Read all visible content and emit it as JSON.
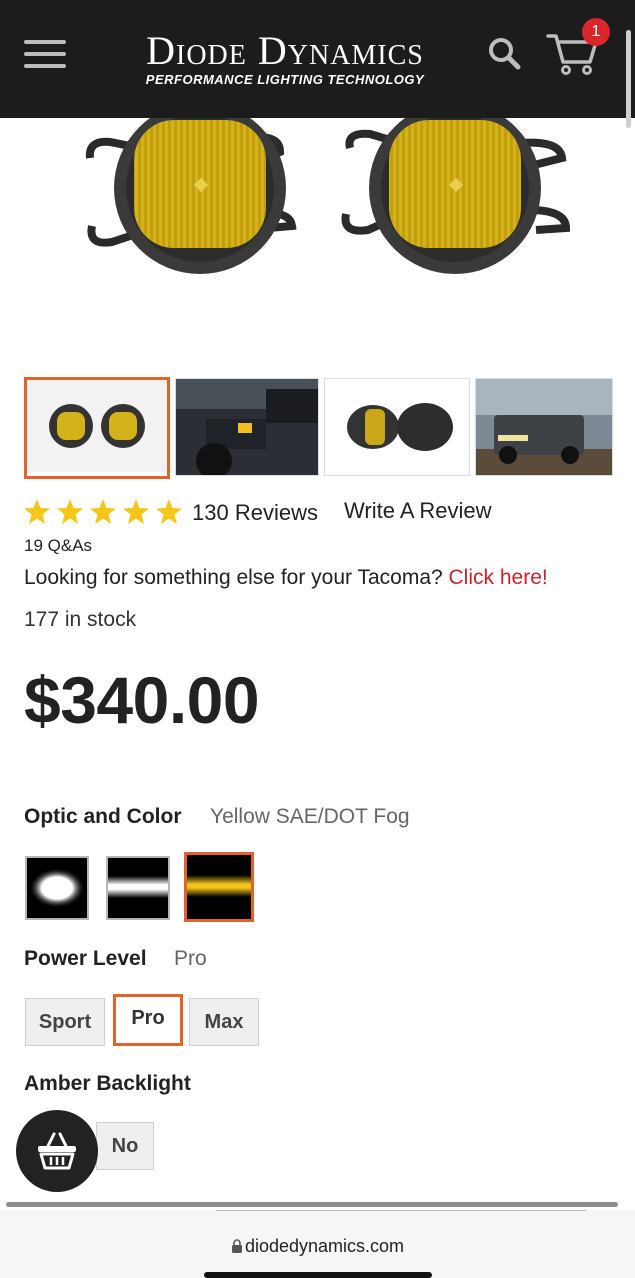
{
  "header": {
    "brand": "Diode Dynamics",
    "tagline": "PERFORMANCE LIGHTING TECHNOLOGY",
    "cart_count": "1"
  },
  "gallery": {
    "thumbnails": [
      "fog-lights-pair",
      "tacoma-front-bumper",
      "fog-lights-side",
      "tacoma-truck"
    ],
    "active_index": 0
  },
  "reviews": {
    "rating": 5,
    "count_label": "130 Reviews",
    "write_label": "Write A Review",
    "qa_label": "19 Q&As"
  },
  "promo": {
    "text": "Looking for something else for your Tacoma? ",
    "link": "Click here!"
  },
  "stock": "177 in stock",
  "price": "$340.00",
  "options": {
    "optic": {
      "label": "Optic and Color",
      "value": "Yellow SAE/DOT Fog",
      "swatches": [
        "white-flood",
        "white-fog",
        "yellow-fog"
      ],
      "selected": "yellow-fog"
    },
    "power": {
      "label": "Power Level",
      "value": "Pro",
      "choices": [
        "Sport",
        "Pro",
        "Max"
      ],
      "selected": "Pro"
    },
    "backlight": {
      "label": "Amber Backlight",
      "choices": [
        "No"
      ]
    }
  },
  "browser": {
    "url": "diodedynamics.com"
  },
  "colors": {
    "accent": "#e2622a",
    "link_red": "#c9232b",
    "star": "#f5c518",
    "header_bg": "#1c1c1c"
  }
}
